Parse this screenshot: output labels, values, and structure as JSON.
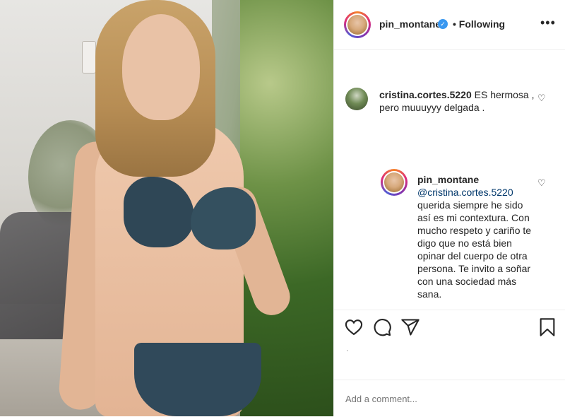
{
  "header": {
    "username": "pin_montane",
    "verified_icon": "verified-badge-icon",
    "following_label": "• Following",
    "more_icon": "more-options-icon"
  },
  "comments": [
    {
      "username": "cristina.cortes.5220",
      "text": "ES hermosa , pero muuuyyy delgada ."
    },
    {
      "username": "pin_montane",
      "mention": "@cristina.cortes.5220",
      "text": "querida siempre he sido así       es mi contextura. Con mucho respeto y cariño te digo que no está bien opinar del cuerpo de otra persona. Te invito a soñar con una sociedad más sana."
    }
  ],
  "actions": {
    "like_icon": "heart-icon",
    "comment_icon": "comment-icon",
    "share_icon": "paper-plane-icon",
    "save_icon": "bookmark-icon"
  },
  "add_comment": {
    "placeholder": "Add a comment..."
  },
  "colors": {
    "text": "#262626",
    "mention": "#00376b",
    "verified": "#3897f0",
    "border": "#efefef",
    "placeholder": "#8e8e8e"
  }
}
